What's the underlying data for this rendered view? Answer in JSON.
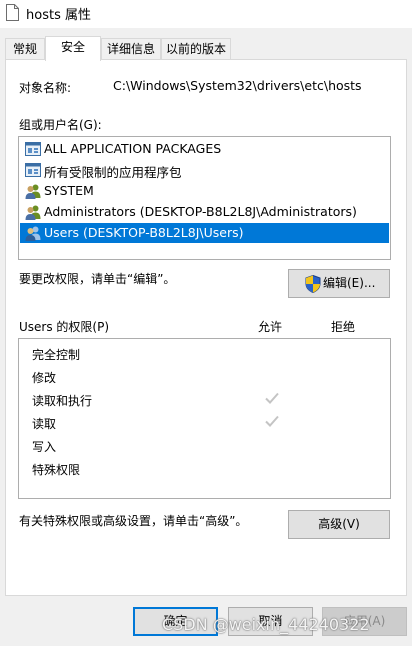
{
  "window": {
    "title": "hosts 属性",
    "icon": "document-icon"
  },
  "tabs": [
    {
      "label": "常规",
      "active": false
    },
    {
      "label": "安全",
      "active": true
    },
    {
      "label": "详细信息",
      "active": false
    },
    {
      "label": "以前的版本",
      "active": false
    }
  ],
  "object": {
    "label": "对象名称:",
    "value": "C:\\Windows\\System32\\drivers\\etc\\hosts"
  },
  "groups": {
    "label": "组或用户名(G):",
    "items": [
      {
        "label": "ALL APPLICATION PACKAGES",
        "icon": "package-icon",
        "selected": false
      },
      {
        "label": "所有受限制的应用程序包",
        "icon": "package-icon",
        "selected": false
      },
      {
        "label": "SYSTEM",
        "icon": "users-icon",
        "selected": false
      },
      {
        "label": "Administrators (DESKTOP-B8L2L8J\\Administrators)",
        "icon": "users-icon",
        "selected": false
      },
      {
        "label": "Users (DESKTOP-B8L2L8J\\Users)",
        "icon": "users-icon",
        "selected": true
      }
    ]
  },
  "edit_hint": "要更改权限，请单击“编辑”。",
  "edit_button": {
    "label": "编辑(E)...",
    "icon": "uac-shield-icon"
  },
  "permissions": {
    "label": "Users 的权限(P)",
    "allow_header": "允许",
    "deny_header": "拒绝",
    "rows": [
      {
        "name": "完全控制",
        "allow": false,
        "deny": false
      },
      {
        "name": "修改",
        "allow": false,
        "deny": false
      },
      {
        "name": "读取和执行",
        "allow": true,
        "deny": false
      },
      {
        "name": "读取",
        "allow": true,
        "deny": false
      },
      {
        "name": "写入",
        "allow": false,
        "deny": false
      },
      {
        "name": "特殊权限",
        "allow": false,
        "deny": false
      }
    ]
  },
  "advanced_hint": "有关特殊权限或高级设置，请单击“高级”。",
  "advanced_button": "高级(V)",
  "footer": {
    "ok": "确定",
    "cancel": "取消",
    "apply": "应用(A)"
  },
  "watermark": "CSDN @weixin_44240322",
  "colors": {
    "selection": "#0078d7",
    "check": "#c4c4c4"
  }
}
